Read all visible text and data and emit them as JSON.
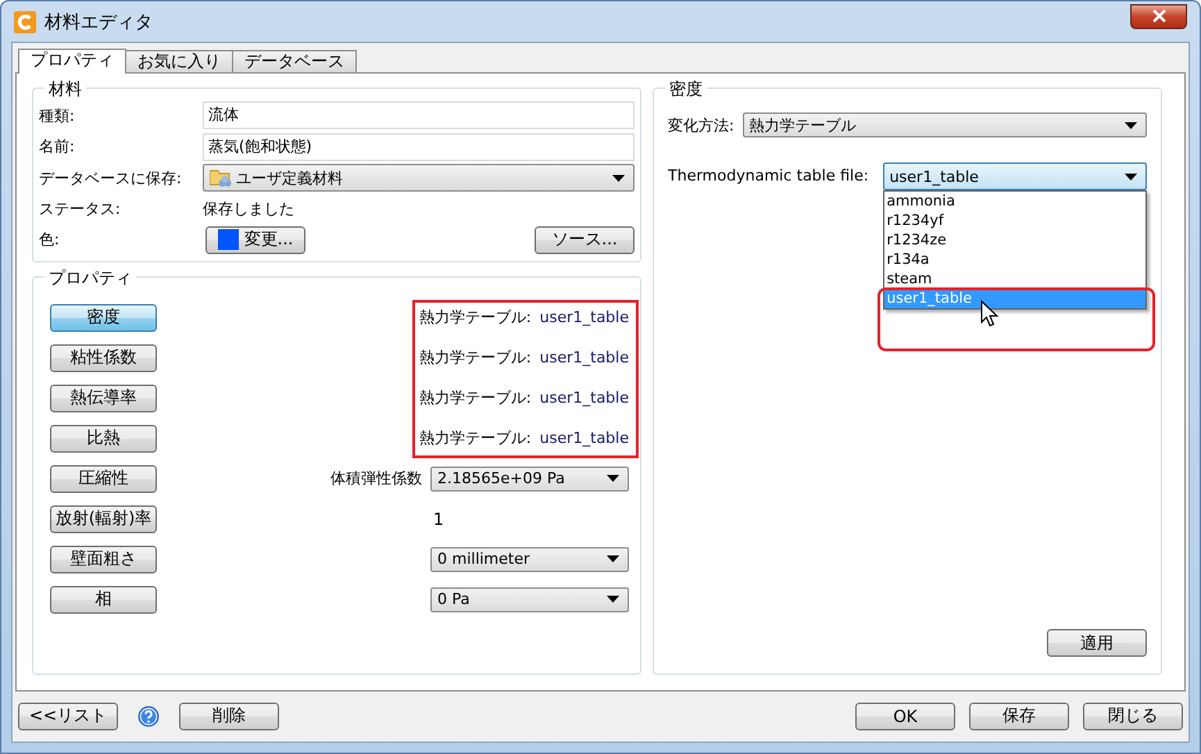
{
  "window": {
    "title": "材料エディタ"
  },
  "tabs": [
    {
      "label": "プロパティ",
      "selected": true
    },
    {
      "label": "お気に入り",
      "selected": false
    },
    {
      "label": "データベース",
      "selected": false
    }
  ],
  "material": {
    "title": "材料",
    "type": {
      "label": "種類:",
      "value": "流体"
    },
    "name": {
      "label": "名前:",
      "value": "蒸気(飽和状態)"
    },
    "database": {
      "label": "データベースに保存:",
      "value": "ユーザ定義材料"
    },
    "status": {
      "label": "ステータス:",
      "value": "保存しました"
    },
    "color": {
      "label": "色:",
      "button": "変更...",
      "color": "#0055ff"
    },
    "source_button": "ソース..."
  },
  "properties": {
    "title": "プロパティ",
    "rows": [
      {
        "button": "密度",
        "selected": true,
        "kind": "table",
        "label": "熱力学テーブル:",
        "value": "user1_table",
        "highlighted": true
      },
      {
        "button": "粘性係数",
        "selected": false,
        "kind": "table",
        "label": "熱力学テーブル:",
        "value": "user1_table",
        "highlighted": true
      },
      {
        "button": "熱伝導率",
        "selected": false,
        "kind": "table",
        "label": "熱力学テーブル:",
        "value": "user1_table",
        "highlighted": true
      },
      {
        "button": "比熱",
        "selected": false,
        "kind": "table",
        "label": "熱力学テーブル:",
        "value": "user1_table",
        "highlighted": true
      },
      {
        "button": "圧縮性",
        "selected": false,
        "kind": "dropdown",
        "label": "体積弾性係数",
        "value": "2.18565e+09 Pa"
      },
      {
        "button": "放射(輻射)率",
        "selected": false,
        "kind": "text",
        "value": "1"
      },
      {
        "button": "壁面粗さ",
        "selected": false,
        "kind": "dropdown",
        "value": "0 millimeter"
      },
      {
        "button": "相",
        "selected": false,
        "kind": "dropdown",
        "value": "0 Pa"
      }
    ]
  },
  "density": {
    "title": "密度",
    "method": {
      "label": "変化方法:",
      "value": "熱力学テーブル"
    },
    "table_file": {
      "label": "Thermodynamic table file:",
      "value": "user1_table",
      "expanded": true,
      "options": [
        {
          "label": "ammonia",
          "selected": false
        },
        {
          "label": "r1234yf",
          "selected": false
        },
        {
          "label": "r1234ze",
          "selected": false
        },
        {
          "label": "r134a",
          "selected": false
        },
        {
          "label": "steam",
          "selected": false
        },
        {
          "label": "user1_table",
          "selected": true,
          "highlighted": true
        }
      ]
    },
    "apply_button": "適用"
  },
  "footer": {
    "list_button": "<<リスト",
    "delete_button": "削除",
    "ok_button": "OK",
    "save_button": "保存",
    "close_button": "閉じる"
  }
}
